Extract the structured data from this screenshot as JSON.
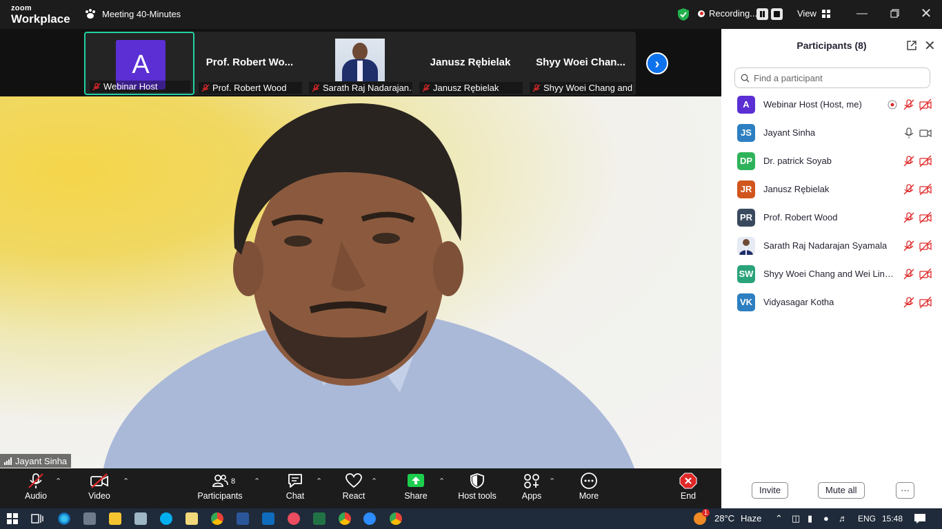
{
  "titlebar": {
    "logo_top": "zoom",
    "logo_bottom": "Workplace",
    "meeting_title": "Meeting 40-Minutes",
    "recording_label": "Recording...",
    "view_label": "View"
  },
  "gallery": {
    "thumbs": [
      {
        "big": "",
        "avatar_letter": "A",
        "name": "Webinar Host"
      },
      {
        "big": "Prof.  Robert  Wo...",
        "name": "Prof. Robert Wood"
      },
      {
        "big": "",
        "name": "Sarath Raj Nadarajan..."
      },
      {
        "big": "Janusz Rębielak",
        "name": "Janusz Rębielak"
      },
      {
        "big": "Shyy  Woei  Chan...",
        "name": "Shyy Woei Chang and..."
      }
    ]
  },
  "main_video": {
    "speaker_name": "Jayant Sinha"
  },
  "participants": {
    "title": "Participants (8)",
    "search_placeholder": "Find a participant",
    "list": [
      {
        "initials": "A",
        "name": "Webinar Host (Host, me)",
        "color": "#5b2fd3"
      },
      {
        "initials": "JS",
        "name": "Jayant Sinha",
        "color": "#2d7fc1"
      },
      {
        "initials": "DP",
        "name": "Dr. patrick Soyab",
        "color": "#2fb35a"
      },
      {
        "initials": "JR",
        "name": "Janusz Rębielak",
        "color": "#d1561d"
      },
      {
        "initials": "PR",
        "name": "Prof. Robert Wood",
        "color": "#3a4a5e"
      },
      {
        "initials": "",
        "name": "Sarath Raj Nadarajan Syamala",
        "color": "#e6ebf3"
      },
      {
        "initials": "SW",
        "name": "Shyy Woei Chang and Wei Ling ...",
        "color": "#2aa37a"
      },
      {
        "initials": "VK",
        "name": "Vidyasagar Kotha",
        "color": "#2d7fc1"
      }
    ],
    "invite_label": "Invite",
    "mute_all_label": "Mute all",
    "more_label": "···"
  },
  "toolbar": {
    "audio": "Audio",
    "video": "Video",
    "participants": "Participants",
    "participants_count": "8",
    "chat": "Chat",
    "react": "React",
    "share": "Share",
    "host_tools": "Host tools",
    "apps": "Apps",
    "more": "More",
    "end": "End"
  },
  "taskbar": {
    "temperature": "28°C",
    "weather": "Haze",
    "language": "ENG",
    "time": "15:48",
    "badge": "1"
  },
  "colors": {
    "accent_green": "#22d3a4",
    "zoom_blue": "#0e72ed",
    "mute_red": "#e02828",
    "share_green": "#1dce4e"
  }
}
